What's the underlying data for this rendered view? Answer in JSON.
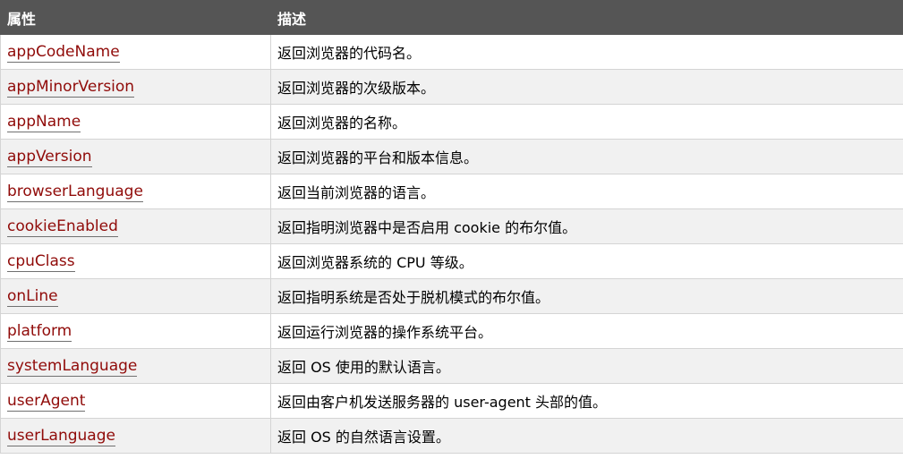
{
  "header": {
    "col1": "属性",
    "col2": "描述"
  },
  "rows": [
    {
      "name": "appCodeName",
      "desc": "返回浏览器的代码名。"
    },
    {
      "name": "appMinorVersion",
      "desc": "返回浏览器的次级版本。"
    },
    {
      "name": "appName",
      "desc": "返回浏览器的名称。"
    },
    {
      "name": "appVersion",
      "desc": "返回浏览器的平台和版本信息。"
    },
    {
      "name": "browserLanguage",
      "desc": "返回当前浏览器的语言。"
    },
    {
      "name": "cookieEnabled",
      "desc": "返回指明浏览器中是否启用 cookie 的布尔值。"
    },
    {
      "name": "cpuClass",
      "desc": "返回浏览器系统的 CPU 等级。"
    },
    {
      "name": "onLine",
      "desc": "返回指明系统是否处于脱机模式的布尔值。"
    },
    {
      "name": "platform",
      "desc": "返回运行浏览器的操作系统平台。"
    },
    {
      "name": "systemLanguage",
      "desc": "返回 OS 使用的默认语言。"
    },
    {
      "name": "userAgent",
      "desc": "返回由客户机发送服务器的 user-agent 头部的值。"
    },
    {
      "name": "userLanguage",
      "desc": "返回 OS 的自然语言设置。"
    }
  ],
  "colors": {
    "header_bg": "#555555",
    "link": "#900b09",
    "alt_row": "#f1f1f1",
    "border": "#d4d4d4"
  }
}
